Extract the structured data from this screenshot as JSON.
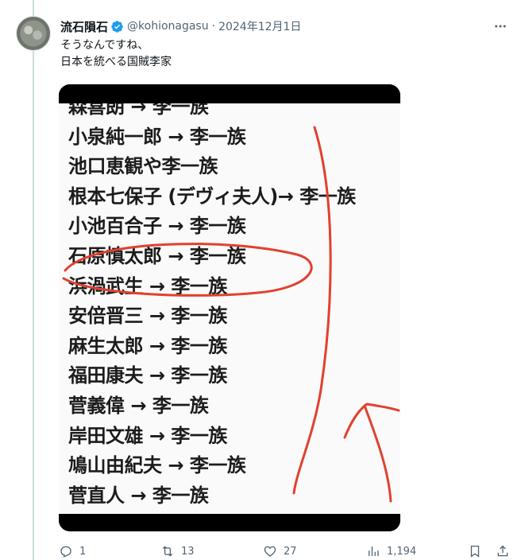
{
  "tweet": {
    "display_name": "流石隕石",
    "handle": "@kohionagasu",
    "separator": "·",
    "date": "2024年12月1日",
    "text_line1": "そうなんですね、",
    "text_line2": "日本を統べる国賊李家"
  },
  "image_text": {
    "lines": [
      "森喜朗 → 李一族",
      "小泉純一郎 → 李一族",
      "池口恵観や李一族",
      "根本七保子 (デヴィ夫人)→ 李一族",
      "小池百合子 → 李一族",
      "石原慎太郎 → 李一族",
      "浜渦武生 → 李一族",
      "安倍晋三 → 李一族",
      "麻生太郎 → 李一族",
      "福田康夫 → 李一族",
      "菅義偉 → 李一族",
      "岸田文雄 → 李一族",
      "鳩山由紀夫 → 李一族",
      "菅直人 → 李一族"
    ]
  },
  "actions": {
    "reply_count": "1",
    "retweet_count": "13",
    "like_count": "27",
    "view_count": "1,194"
  },
  "icons": {
    "verified": "verified-badge-icon",
    "more": "more-icon",
    "reply": "reply-icon",
    "retweet": "retweet-icon",
    "like": "heart-icon",
    "views": "views-icon",
    "bookmark": "bookmark-icon",
    "share": "share-icon"
  },
  "colors": {
    "accent": "#1d9bf0",
    "secondary_text": "#536471",
    "annotation_red": "#e2402f"
  }
}
